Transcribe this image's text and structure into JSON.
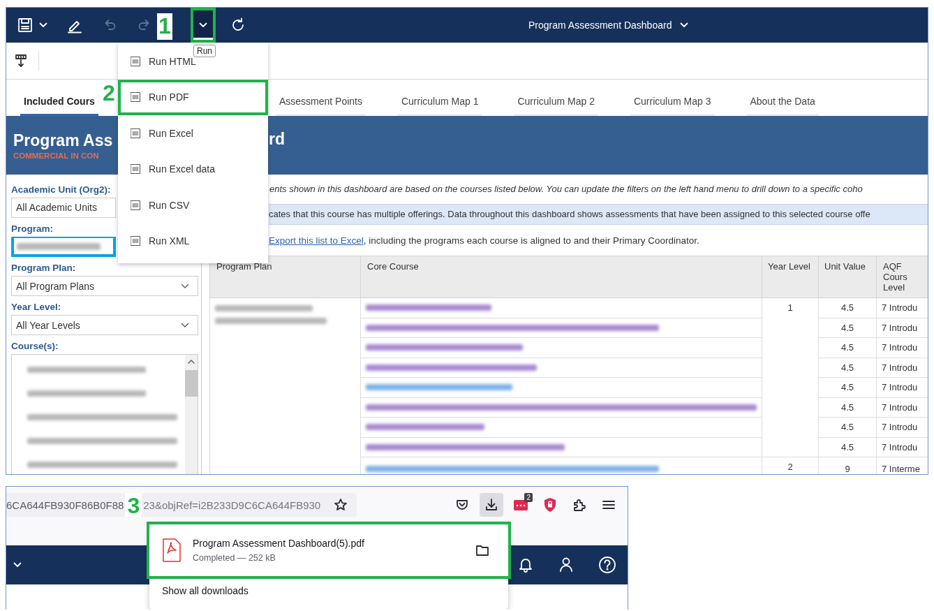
{
  "toolbar": {
    "buttons": [
      {
        "kind": "save",
        "disabled": false,
        "boxed": false
      },
      {
        "kind": "edit",
        "disabled": false,
        "boxed": false
      },
      {
        "kind": "undo",
        "disabled": true,
        "boxed": false
      },
      {
        "kind": "redo",
        "disabled": true,
        "boxed": false
      },
      {
        "kind": "run",
        "disabled": false,
        "boxed": true
      },
      {
        "kind": "refresh",
        "disabled": false,
        "boxed": false
      }
    ],
    "annotation": "1",
    "tooltip": "Run",
    "report_title": "Program Assessment Dashboard"
  },
  "tabs": [
    {
      "label": "Included Cours",
      "selected": true
    },
    {
      "label": "Assessment Points",
      "selected": false
    },
    {
      "label": "Curriculum Map 1",
      "selected": false
    },
    {
      "label": "Curriculum Map 2",
      "selected": false
    },
    {
      "label": "Curriculum Map 3",
      "selected": false
    },
    {
      "label": "About the Data",
      "selected": false
    }
  ],
  "header": {
    "title_parts": [
      "Program Ass",
      "rd"
    ],
    "subtitle": "COMMERCIAL IN CON"
  },
  "filters": [
    {
      "label": "Academic Unit (Org2):",
      "kind": "text",
      "value": "All Academic Units",
      "highlighted": false
    },
    {
      "label": "Program:",
      "kind": "blurred",
      "highlighted": true
    },
    {
      "label": "Program Plan:",
      "kind": "select",
      "value": "All Program Plans",
      "highlighted": false
    },
    {
      "label": "Year Level:",
      "kind": "select",
      "value": "All Year Levels",
      "highlighted": false
    },
    {
      "label": "Course(s):",
      "kind": "list",
      "highlighted": false,
      "items": [
        {
          "kind": "blurred"
        },
        {
          "kind": "blurred"
        },
        {
          "kind": "blurred"
        },
        {
          "kind": "blurred"
        },
        {
          "kind": "blurred"
        }
      ]
    }
  ],
  "intro": "ents shown in this dashboard are based on the courses listed below. You can update the filters on the left hand menu to drill down to a specific coho",
  "notice": "cates that this course has multiple offerings. Data throughout this dashboard shows assessments that have been assigned to this selected course offe",
  "export": {
    "link": "Export this list to Excel",
    "text": ", including the programs each course is aligned to and their Primary Coordinator."
  },
  "table": {
    "columns": [
      "Program Plan",
      "Core Course",
      "Year Level",
      "Unit Value",
      "AQF Cours Level"
    ],
    "groups": [
      {
        "year": "1",
        "rows": [
          {
            "visited": true,
            "unit": "4.5",
            "aqf": "7 Introdu"
          },
          {
            "visited": true,
            "unit": "4.5",
            "aqf": "7 Introdu"
          },
          {
            "visited": true,
            "unit": "4.5",
            "aqf": "7 Introdu"
          },
          {
            "visited": true,
            "unit": "4.5",
            "aqf": "7 Introdu"
          },
          {
            "visited": false,
            "unit": "4.5",
            "aqf": "7 Introdu"
          },
          {
            "visited": true,
            "unit": "4.5",
            "aqf": "7 Introdu"
          },
          {
            "visited": true,
            "unit": "4.5",
            "aqf": "7 Introdu"
          },
          {
            "visited": true,
            "unit": "4.5",
            "aqf": "7 Introdu"
          }
        ]
      },
      {
        "year": "2",
        "rows": [
          {
            "visited": false,
            "unit": "9",
            "aqf": "7 Interme"
          }
        ]
      }
    ]
  },
  "menu": {
    "annotation": "2",
    "items": [
      {
        "label": "Run HTML",
        "boxed": false
      },
      {
        "label": "Run PDF",
        "boxed": true
      },
      {
        "label": "Run Excel",
        "boxed": false
      },
      {
        "label": "Run Excel data",
        "boxed": false
      },
      {
        "label": "Run CSV",
        "boxed": false
      },
      {
        "label": "Run XML",
        "boxed": false
      }
    ]
  },
  "browser": {
    "url_parts": [
      "6CA644FB930F86B0F88",
      "23&objRef=i2B233D9C6CA644FB930"
    ],
    "annotation": "3",
    "downloads_active": true,
    "extension_badge": "2",
    "downloads": {
      "file": "Program Assessment Dashboard(5).pdf",
      "status": "Completed — 252 kB",
      "boxed": true,
      "show_all": "Show all downloads"
    }
  }
}
